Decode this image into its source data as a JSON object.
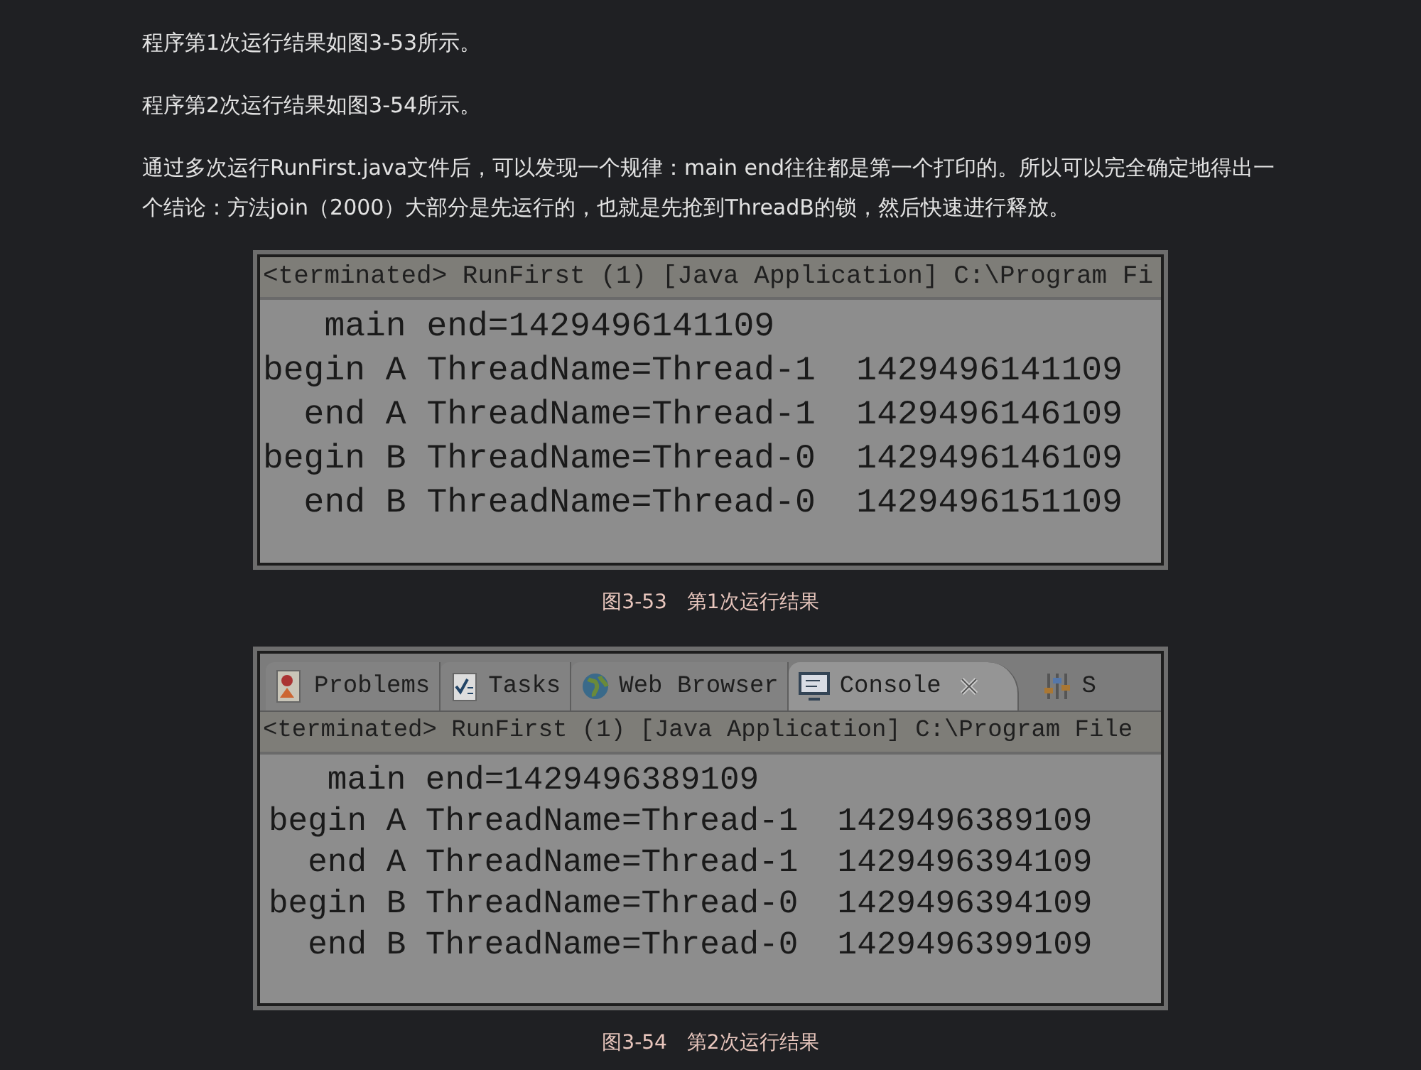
{
  "paragraphs": [
    "程序第1次运行结果如图3-53所示。",
    "程序第2次运行结果如图3-54所示。",
    "通过多次运行RunFirst.java文件后，可以发现一个规律：main end往往都是第一个打印的。所以可以完全确定地得出一个结论：方法join（2000）大部分是先运行的，也就是先抢到ThreadB的锁，然后快速进行释放。"
  ],
  "figures": [
    {
      "header": "<terminated> RunFirst (1) [Java Application] C:\\Program Fi",
      "lines": [
        "   main end=1429496141109",
        "begin A ThreadName=Thread-1  1429496141109",
        "  end A ThreadName=Thread-1  1429496146109",
        "begin B ThreadName=Thread-0  1429496146109",
        "  end B ThreadName=Thread-0  1429496151109"
      ],
      "caption": "图3-53　第1次运行结果"
    },
    {
      "tabs": [
        {
          "label": "Problems",
          "kind": "problems",
          "selected": false
        },
        {
          "label": "Tasks",
          "kind": "tasks",
          "selected": false
        },
        {
          "label": "Web Browser",
          "kind": "browser",
          "selected": false
        },
        {
          "label": "Console",
          "kind": "console",
          "selected": true
        },
        {
          "label": "S",
          "kind": "servers",
          "selected": false
        }
      ],
      "header": "<terminated> RunFirst (1) [Java Application] C:\\Program File",
      "lines": [
        "   main end=1429496389109",
        "begin A ThreadName=Thread-1  1429496389109",
        "  end A ThreadName=Thread-1  1429496394109",
        "begin B ThreadName=Thread-0  1429496394109",
        "  end B ThreadName=Thread-0  1429496399109"
      ],
      "caption": "图3-54　第2次运行结果"
    }
  ]
}
